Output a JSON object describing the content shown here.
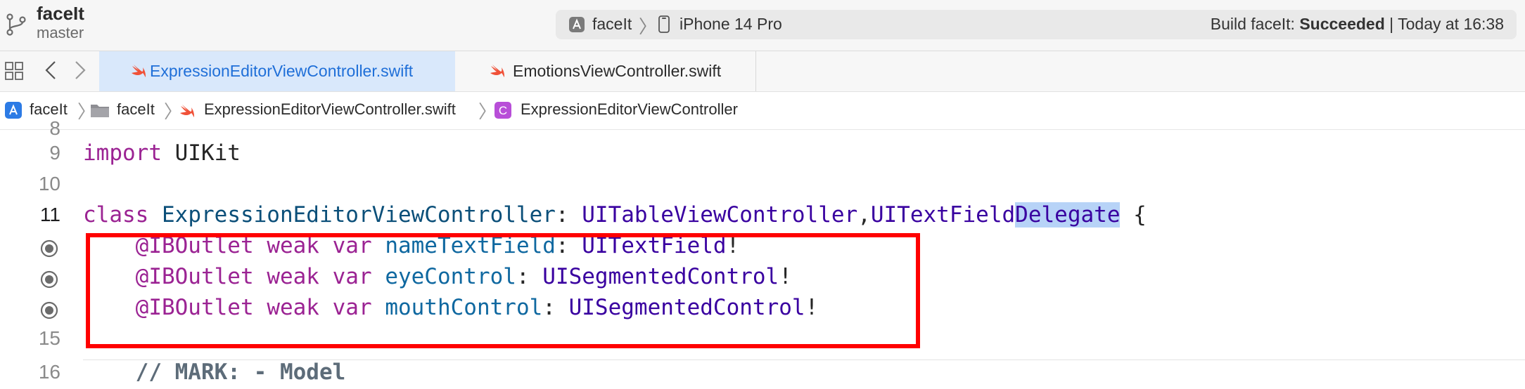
{
  "toolbar": {
    "project_name": "faceIt",
    "branch_name": "master",
    "scheme_name": "faceIt",
    "device_name": "iPhone 14 Pro",
    "status_prefix": "Build faceIt: ",
    "status_result": "Succeeded",
    "status_suffix": " | Today at 16:38"
  },
  "tabs": [
    {
      "label": "ExpressionEditorViewController.swift",
      "active": true
    },
    {
      "label": "EmotionsViewController.swift",
      "active": false
    }
  ],
  "breadcrumb": [
    {
      "label": "faceIt",
      "icon": "app-project-icon"
    },
    {
      "label": "faceIt",
      "icon": "folder-icon"
    },
    {
      "label": "ExpressionEditorViewController.swift",
      "icon": "swift-file-icon"
    },
    {
      "label": "ExpressionEditorViewController",
      "icon": "class-c-icon"
    }
  ],
  "editor": {
    "partial_line_number": "8",
    "lines": [
      {
        "number": "9",
        "tokens": [
          {
            "text": "import",
            "kind": "kw"
          },
          {
            "text": " UIKit",
            "kind": "plain"
          }
        ]
      },
      {
        "number": "10",
        "tokens": []
      },
      {
        "number": "11",
        "current": true,
        "tokens": [
          {
            "text": "class",
            "kind": "kw"
          },
          {
            "text": " ",
            "kind": "plain"
          },
          {
            "text": "ExpressionEditorViewController",
            "kind": "decl"
          },
          {
            "text": ": ",
            "kind": "plain"
          },
          {
            "text": "UITableViewController",
            "kind": "typ"
          },
          {
            "text": ",",
            "kind": "plain"
          },
          {
            "text": "UITextField",
            "kind": "typ"
          },
          {
            "text": "Delegate",
            "kind": "typ-sel"
          },
          {
            "text": " {",
            "kind": "plain"
          }
        ]
      },
      {
        "number": "",
        "outlet": true,
        "tokens": [
          {
            "text": "    ",
            "kind": "plain"
          },
          {
            "text": "@IBOutlet",
            "kind": "attr"
          },
          {
            "text": " ",
            "kind": "plain"
          },
          {
            "text": "weak",
            "kind": "kw"
          },
          {
            "text": " ",
            "kind": "plain"
          },
          {
            "text": "var",
            "kind": "kw"
          },
          {
            "text": " ",
            "kind": "plain"
          },
          {
            "text": "nameTextField",
            "kind": "prop"
          },
          {
            "text": ": ",
            "kind": "plain"
          },
          {
            "text": "UITextField",
            "kind": "typ"
          },
          {
            "text": "!",
            "kind": "plain"
          }
        ]
      },
      {
        "number": "",
        "outlet": true,
        "tokens": [
          {
            "text": "    ",
            "kind": "plain"
          },
          {
            "text": "@IBOutlet",
            "kind": "attr"
          },
          {
            "text": " ",
            "kind": "plain"
          },
          {
            "text": "weak",
            "kind": "kw"
          },
          {
            "text": " ",
            "kind": "plain"
          },
          {
            "text": "var",
            "kind": "kw"
          },
          {
            "text": " ",
            "kind": "plain"
          },
          {
            "text": "eyeControl",
            "kind": "prop"
          },
          {
            "text": ": ",
            "kind": "plain"
          },
          {
            "text": "UISegmentedControl",
            "kind": "typ"
          },
          {
            "text": "!",
            "kind": "plain"
          }
        ]
      },
      {
        "number": "",
        "outlet": true,
        "tokens": [
          {
            "text": "    ",
            "kind": "plain"
          },
          {
            "text": "@IBOutlet",
            "kind": "attr"
          },
          {
            "text": " ",
            "kind": "plain"
          },
          {
            "text": "weak",
            "kind": "kw"
          },
          {
            "text": " ",
            "kind": "plain"
          },
          {
            "text": "var",
            "kind": "kw"
          },
          {
            "text": " ",
            "kind": "plain"
          },
          {
            "text": "mouthControl",
            "kind": "prop"
          },
          {
            "text": ": ",
            "kind": "plain"
          },
          {
            "text": "UISegmentedControl",
            "kind": "typ"
          },
          {
            "text": "!",
            "kind": "plain"
          }
        ]
      },
      {
        "number": "15",
        "tokens": []
      },
      {
        "number": "16",
        "tokens": [
          {
            "text": "    ",
            "kind": "plain"
          },
          {
            "text": "// MARK: - Model",
            "kind": "cmt"
          }
        ]
      }
    ]
  },
  "colors": {
    "keyword": "#9b2393",
    "type": "#3900a0",
    "property": "#0f68a0",
    "comment": "#5d6c79",
    "selection": "#b7d3f7",
    "active_tab_bg": "#d9e8fb",
    "active_tab_text": "#1f6fd8",
    "annotation_box": "#ff0000"
  }
}
